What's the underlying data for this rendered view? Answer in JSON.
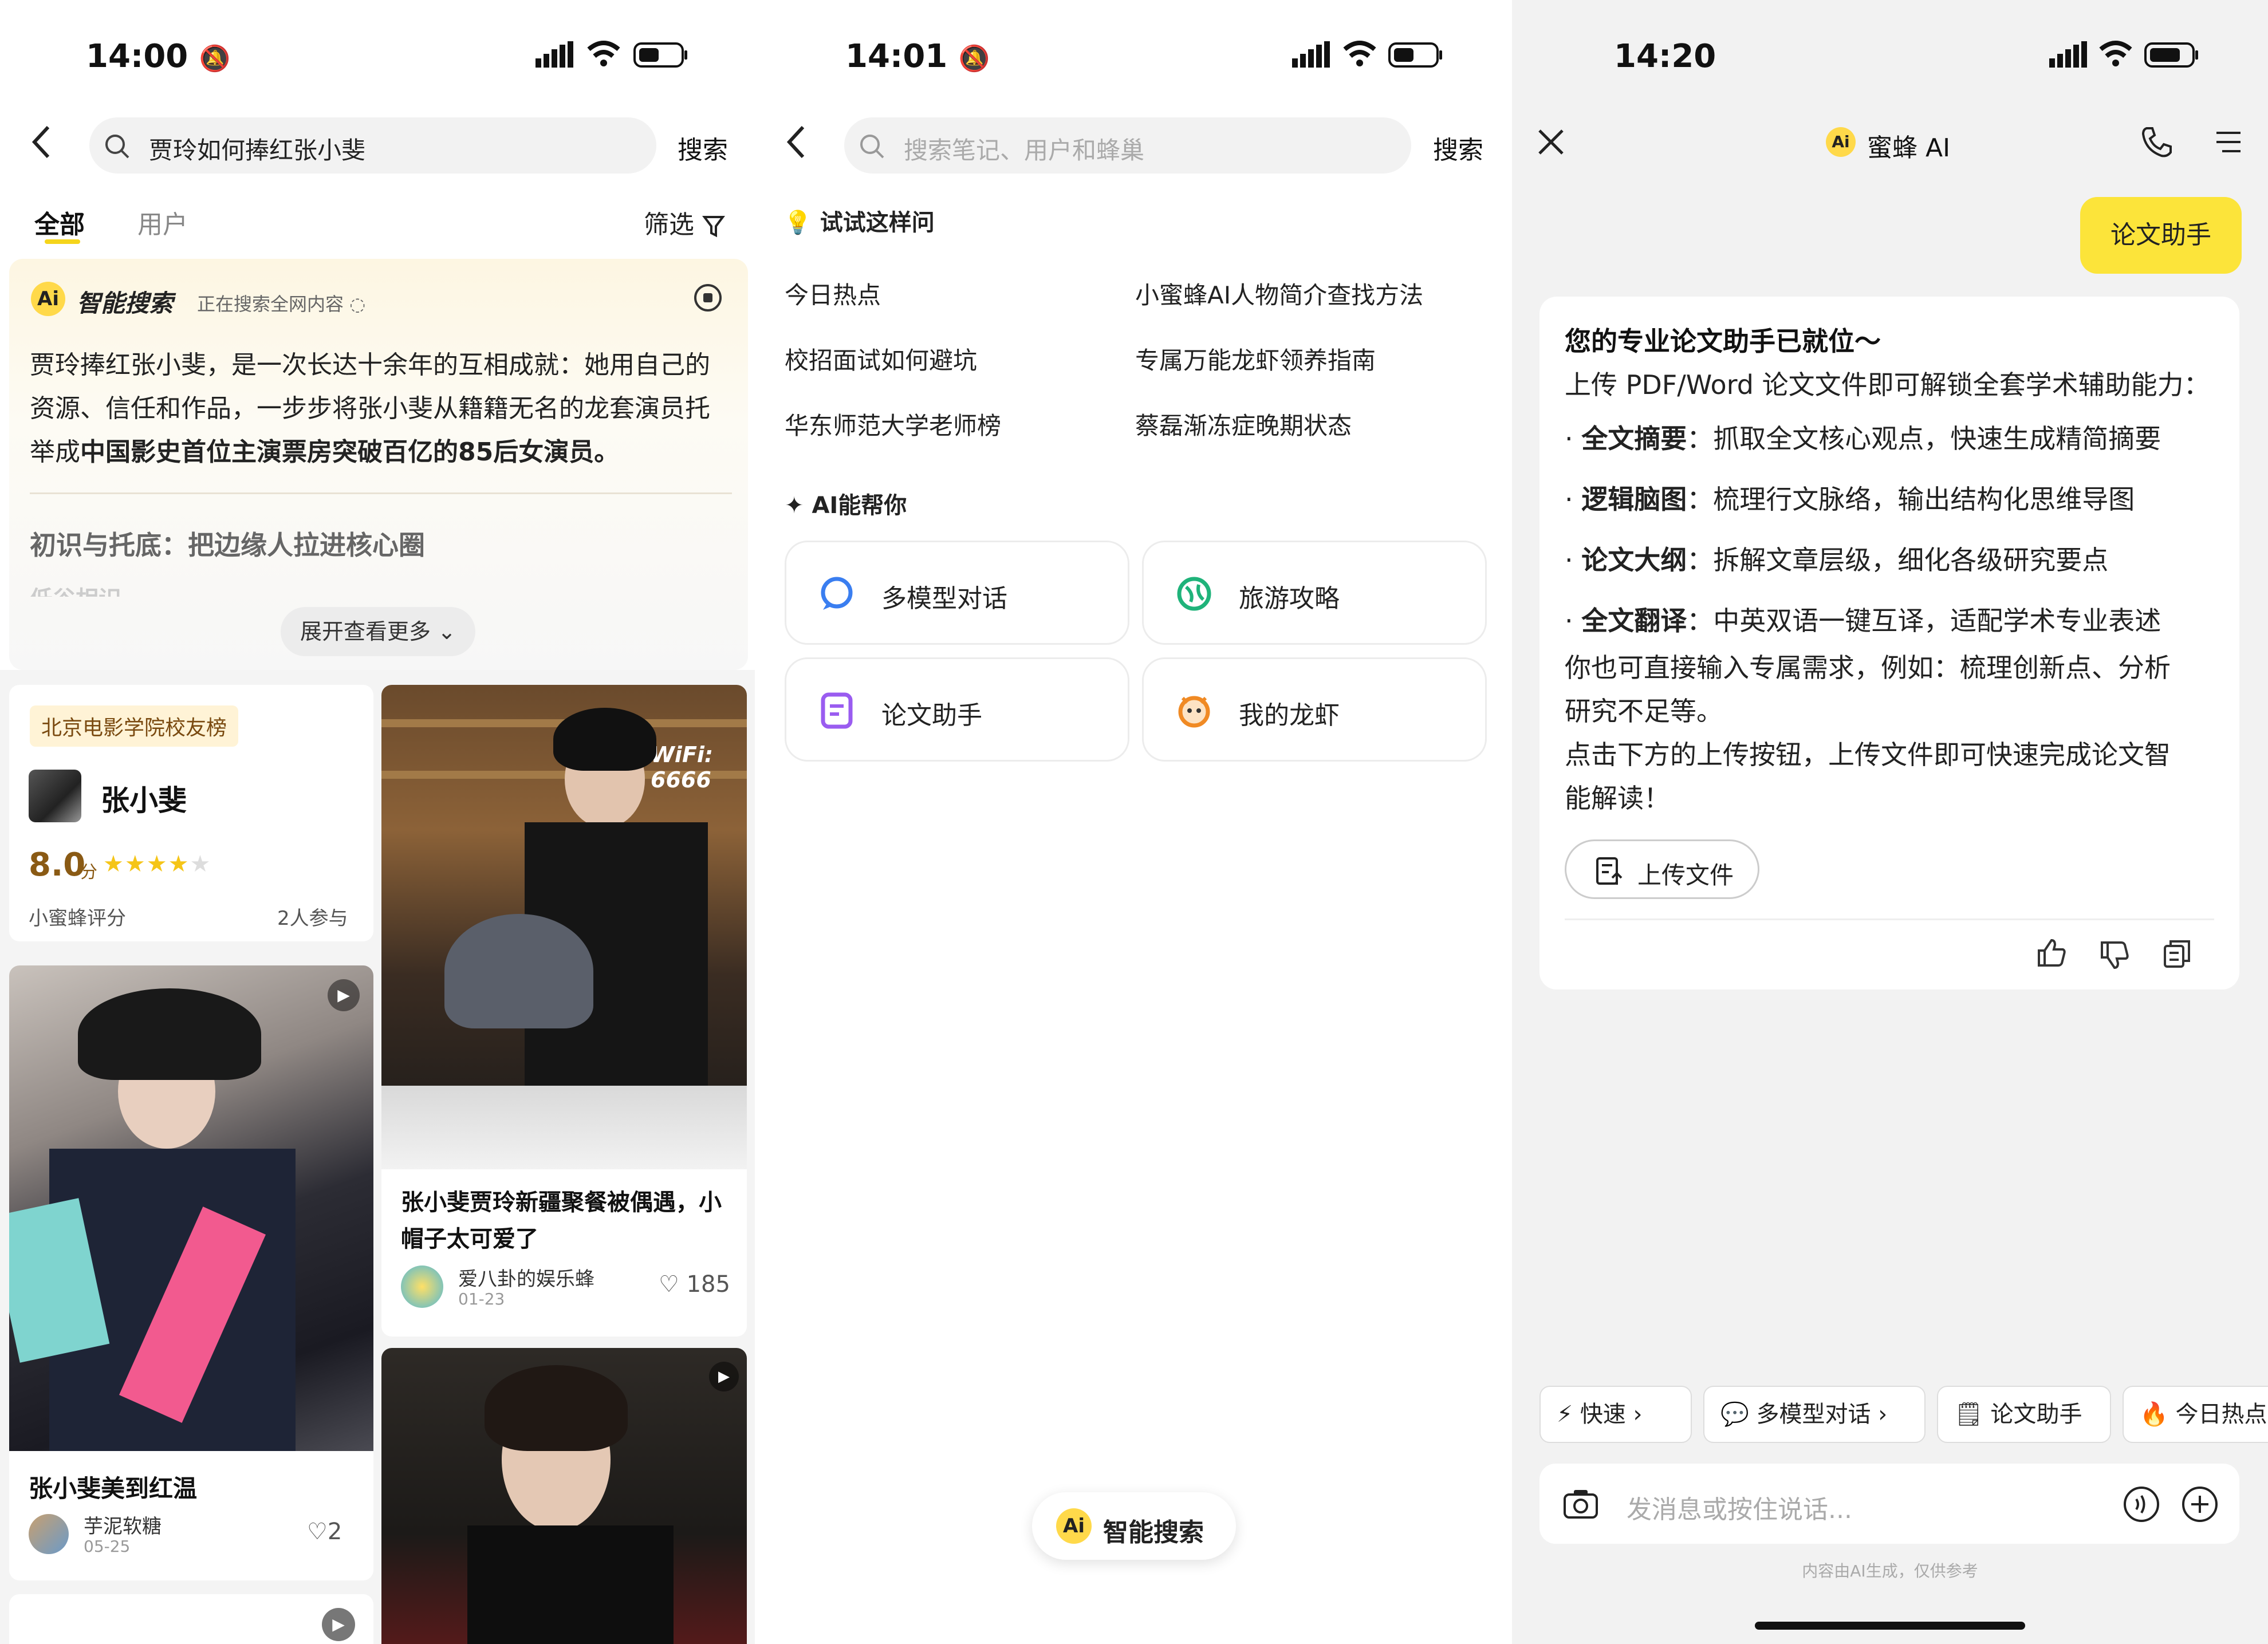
{
  "panel1": {
    "status": {
      "time": "14:00"
    },
    "search": {
      "query": "贾玲如何捧红张小斐",
      "button": "搜索"
    },
    "tabs": {
      "all": "全部",
      "user": "用户",
      "filter": "筛选"
    },
    "smart": {
      "title": "智能搜索",
      "status": "正在搜索全网内容",
      "body_pre": "贾玲捧红张小斐，是一次长达十余年的互相成就：她用自己的资源、信任和作品，一步步将张小斐从籍籍无名的龙套演员托举成",
      "body_bold": "中国影史首位主演票房突破百亿的85后女演员。",
      "section_heading": "初识与托底：把边缘人拉进核心圈",
      "faded": "低谷相识",
      "expand": "展开查看更多"
    },
    "rating_card": {
      "tag": "北京电影学院校友榜",
      "name": "张小斐",
      "score": "8.0",
      "score_unit": "分",
      "stars": 4,
      "source": "小蜜蜂评分",
      "participants": "2人参与"
    },
    "post_left": {
      "title": "张小斐美到红温",
      "author": "芋泥软糖",
      "date": "05-25",
      "likes": "2"
    },
    "post_right": {
      "title": "张小斐贾玲新疆聚餐被偶遇，小帽子太可爱了",
      "author": "爱八卦的娱乐蜂",
      "date": "01-23",
      "likes": "185",
      "watermark": "WiFi: 6666"
    }
  },
  "panel2": {
    "status": {
      "time": "14:01"
    },
    "search": {
      "placeholder": "搜索笔记、用户和蜂巢",
      "button": "搜索"
    },
    "try": {
      "title": "试试这样问",
      "items": [
        "今日热点",
        "小蜜蜂AI人物简介查找方法",
        "校招面试如何避坑",
        "专属万能龙虾领养指南",
        "华东师范大学老师榜",
        "蔡磊渐冻症晚期状态"
      ]
    },
    "ai_help": {
      "title": "AI能帮你",
      "cards": [
        "多模型对话",
        "旅游攻略",
        "论文助手",
        "我的龙虾"
      ]
    },
    "smart_button": "智能搜索"
  },
  "panel3": {
    "status": {
      "time": "14:20"
    },
    "header": {
      "title": "蜜蜂 AI"
    },
    "user_bubble": "论文助手",
    "reply": {
      "heading": "您的专业论文助手已就位～",
      "intro": "上传 PDF/Word 论文文件即可解锁全套学术辅助能力：",
      "bullets": [
        {
          "label": "全文摘要",
          "text": "：抓取全文核心观点，快速生成精简摘要"
        },
        {
          "label": "逻辑脑图",
          "text": "：梳理行文脉络，输出结构化思维导图"
        },
        {
          "label": "论文大纲",
          "text": "：拆解文章层级，细化各级研究要点"
        },
        {
          "label": "全文翻译",
          "text": "：中英双语一键互译，适配学术专业表述"
        }
      ],
      "para1_line1": "你也可直接输入专属需求，例如：梳理创新点、分析",
      "para1_line2": "研究不足等。",
      "para2_line1": "点击下方的上传按钮，上传文件即可快速完成论文智",
      "para2_line2": "能解读！",
      "upload": "上传文件"
    },
    "chips": [
      "快速",
      "多模型对话",
      "论文助手",
      "今日热点"
    ],
    "input_placeholder": "发消息或按住说话...",
    "disclaimer": "内容由AI生成，仅供参考"
  },
  "colors": {
    "accent": "#f5d51c",
    "ai_yellow": "#ffd94a"
  }
}
